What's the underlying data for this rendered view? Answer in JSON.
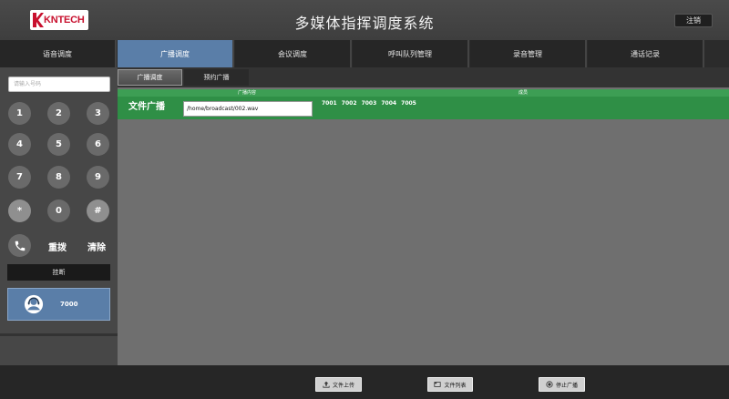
{
  "header": {
    "logo_text": "KNTECH",
    "title": "多媒体指挥调度系统",
    "logout_label": "注销"
  },
  "nav": {
    "tabs": [
      {
        "label": "语音调度"
      },
      {
        "label": "广播调度"
      },
      {
        "label": "会议调度"
      },
      {
        "label": "呼叫队列管理"
      },
      {
        "label": "录音管理"
      },
      {
        "label": "通话记录"
      }
    ],
    "active_index": 1
  },
  "dialpad": {
    "input_placeholder": "请输入号码",
    "keys": [
      "1",
      "2",
      "3",
      "4",
      "5",
      "6",
      "7",
      "8",
      "9",
      "*",
      "0",
      "#"
    ],
    "redial_label": "重拨",
    "clear_label": "清除",
    "hangup_label": "挂断"
  },
  "extension": {
    "number": "7000"
  },
  "sub_tabs": {
    "tabs": [
      {
        "label": "广播调度"
      },
      {
        "label": "预约广播"
      }
    ],
    "active_index": 0
  },
  "broadcast": {
    "content_header": "广播内容",
    "members_header": "成员",
    "type_label": "文件广播",
    "file_path": "/home/broadcast/002.wav",
    "members": "7001 7002 7003 7004 7005"
  },
  "bottom": {
    "upload_label": "文件上传",
    "list_label": "文件列表",
    "stop_label": "停止广播"
  },
  "colors": {
    "accent_blue": "#5a7ea8",
    "broadcast_green": "#2f8f46",
    "brand_red": "#c8102e"
  }
}
